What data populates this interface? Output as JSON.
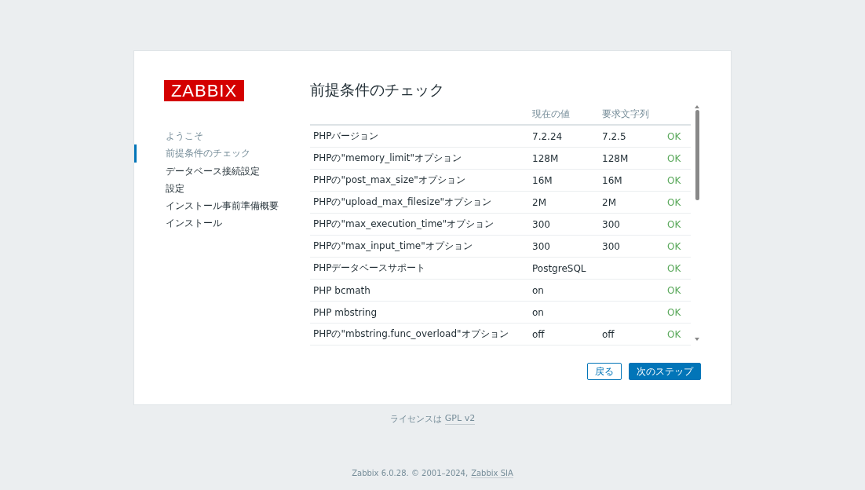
{
  "logo": "ZABBIX",
  "sidebar": {
    "items": [
      {
        "label": "ようこそ",
        "done": true,
        "selected": false
      },
      {
        "label": "前提条件のチェック",
        "done": true,
        "selected": true
      },
      {
        "label": "データベース接続設定",
        "done": false,
        "selected": false
      },
      {
        "label": "設定",
        "done": false,
        "selected": false
      },
      {
        "label": "インストール事前準備概要",
        "done": false,
        "selected": false
      },
      {
        "label": "インストール",
        "done": false,
        "selected": false
      }
    ]
  },
  "title": "前提条件のチェック",
  "table": {
    "columns": [
      "現在の値",
      "要求文字列"
    ],
    "rows": [
      {
        "name": "PHPバージョン",
        "current": "7.2.24",
        "required": "7.2.5",
        "status": "OK",
        "passed": true
      },
      {
        "name": "PHPの\"memory_limit\"オプション",
        "current": "128M",
        "required": "128M",
        "status": "OK",
        "passed": true
      },
      {
        "name": "PHPの\"post_max_size\"オプション",
        "current": "16M",
        "required": "16M",
        "status": "OK",
        "passed": true
      },
      {
        "name": "PHPの\"upload_max_filesize\"オプション",
        "current": "2M",
        "required": "2M",
        "status": "OK",
        "passed": true
      },
      {
        "name": "PHPの\"max_execution_time\"オプション",
        "current": "300",
        "required": "300",
        "status": "OK",
        "passed": true
      },
      {
        "name": "PHPの\"max_input_time\"オプション",
        "current": "300",
        "required": "300",
        "status": "OK",
        "passed": true
      },
      {
        "name": "PHPデータベースサポート",
        "current": "PostgreSQL",
        "status": "OK",
        "passed": true
      },
      {
        "name": "PHP bcmath",
        "current": "on",
        "status": "OK",
        "passed": true
      },
      {
        "name": "PHP mbstring",
        "current": "on",
        "status": "OK",
        "passed": true
      },
      {
        "name": "PHPの\"mbstring.func_overload\"オプション",
        "current": "off",
        "required": "off",
        "status": "OK",
        "passed": true
      }
    ]
  },
  "buttons": {
    "back": "戻る",
    "next": "次のステップ"
  },
  "license": {
    "text": "ライセンスは",
    "link": "GPL v2"
  },
  "footer": {
    "text": "Zabbix 6.0.28. © 2001–2024,",
    "link": "Zabbix SIA"
  }
}
